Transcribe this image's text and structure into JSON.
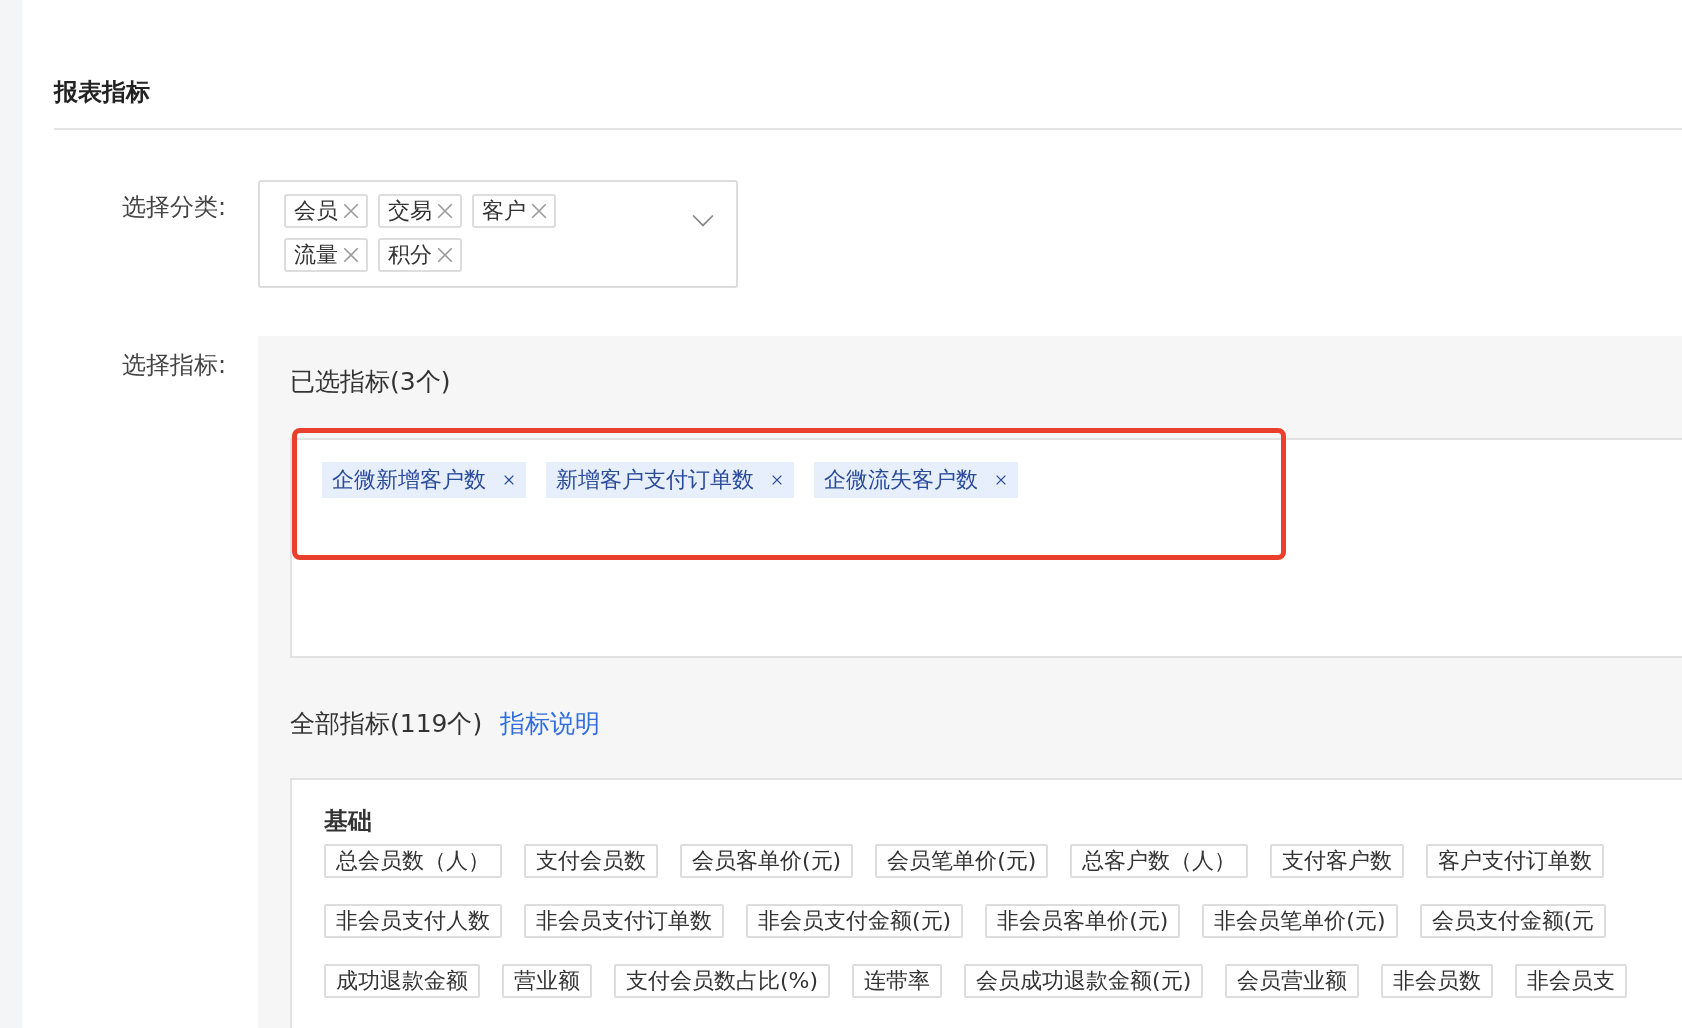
{
  "section_title": "报表指标",
  "category_field": {
    "label": "选择分类:",
    "tags": [
      "会员",
      "交易",
      "客户",
      "流量",
      "积分"
    ]
  },
  "metric_field": {
    "label": "选择指标:",
    "selected_heading": "已选指标(3个)",
    "selected_metrics": [
      "企微新增客户数",
      "新增客户支付订单数",
      "企微流失客户数"
    ],
    "all_heading": "全部指标(119个)",
    "help_link": "指标说明",
    "groups": [
      {
        "title": "基础",
        "metrics": [
          "总会员数（人）",
          "支付会员数",
          "会员客单价(元)",
          "会员笔单价(元)",
          "总客户数（人）",
          "支付客户数",
          "客户支付订单数",
          "非会员支付人数",
          "非会员支付订单数",
          "非会员支付金额(元)",
          "非会员客单价(元)",
          "非会员笔单价(元)",
          "会员支付金额(元",
          "成功退款金额",
          "营业额",
          "支付会员数占比(%)",
          "连带率",
          "会员成功退款金额(元)",
          "会员营业额",
          "非会员数",
          "非会员支"
        ]
      }
    ]
  }
}
